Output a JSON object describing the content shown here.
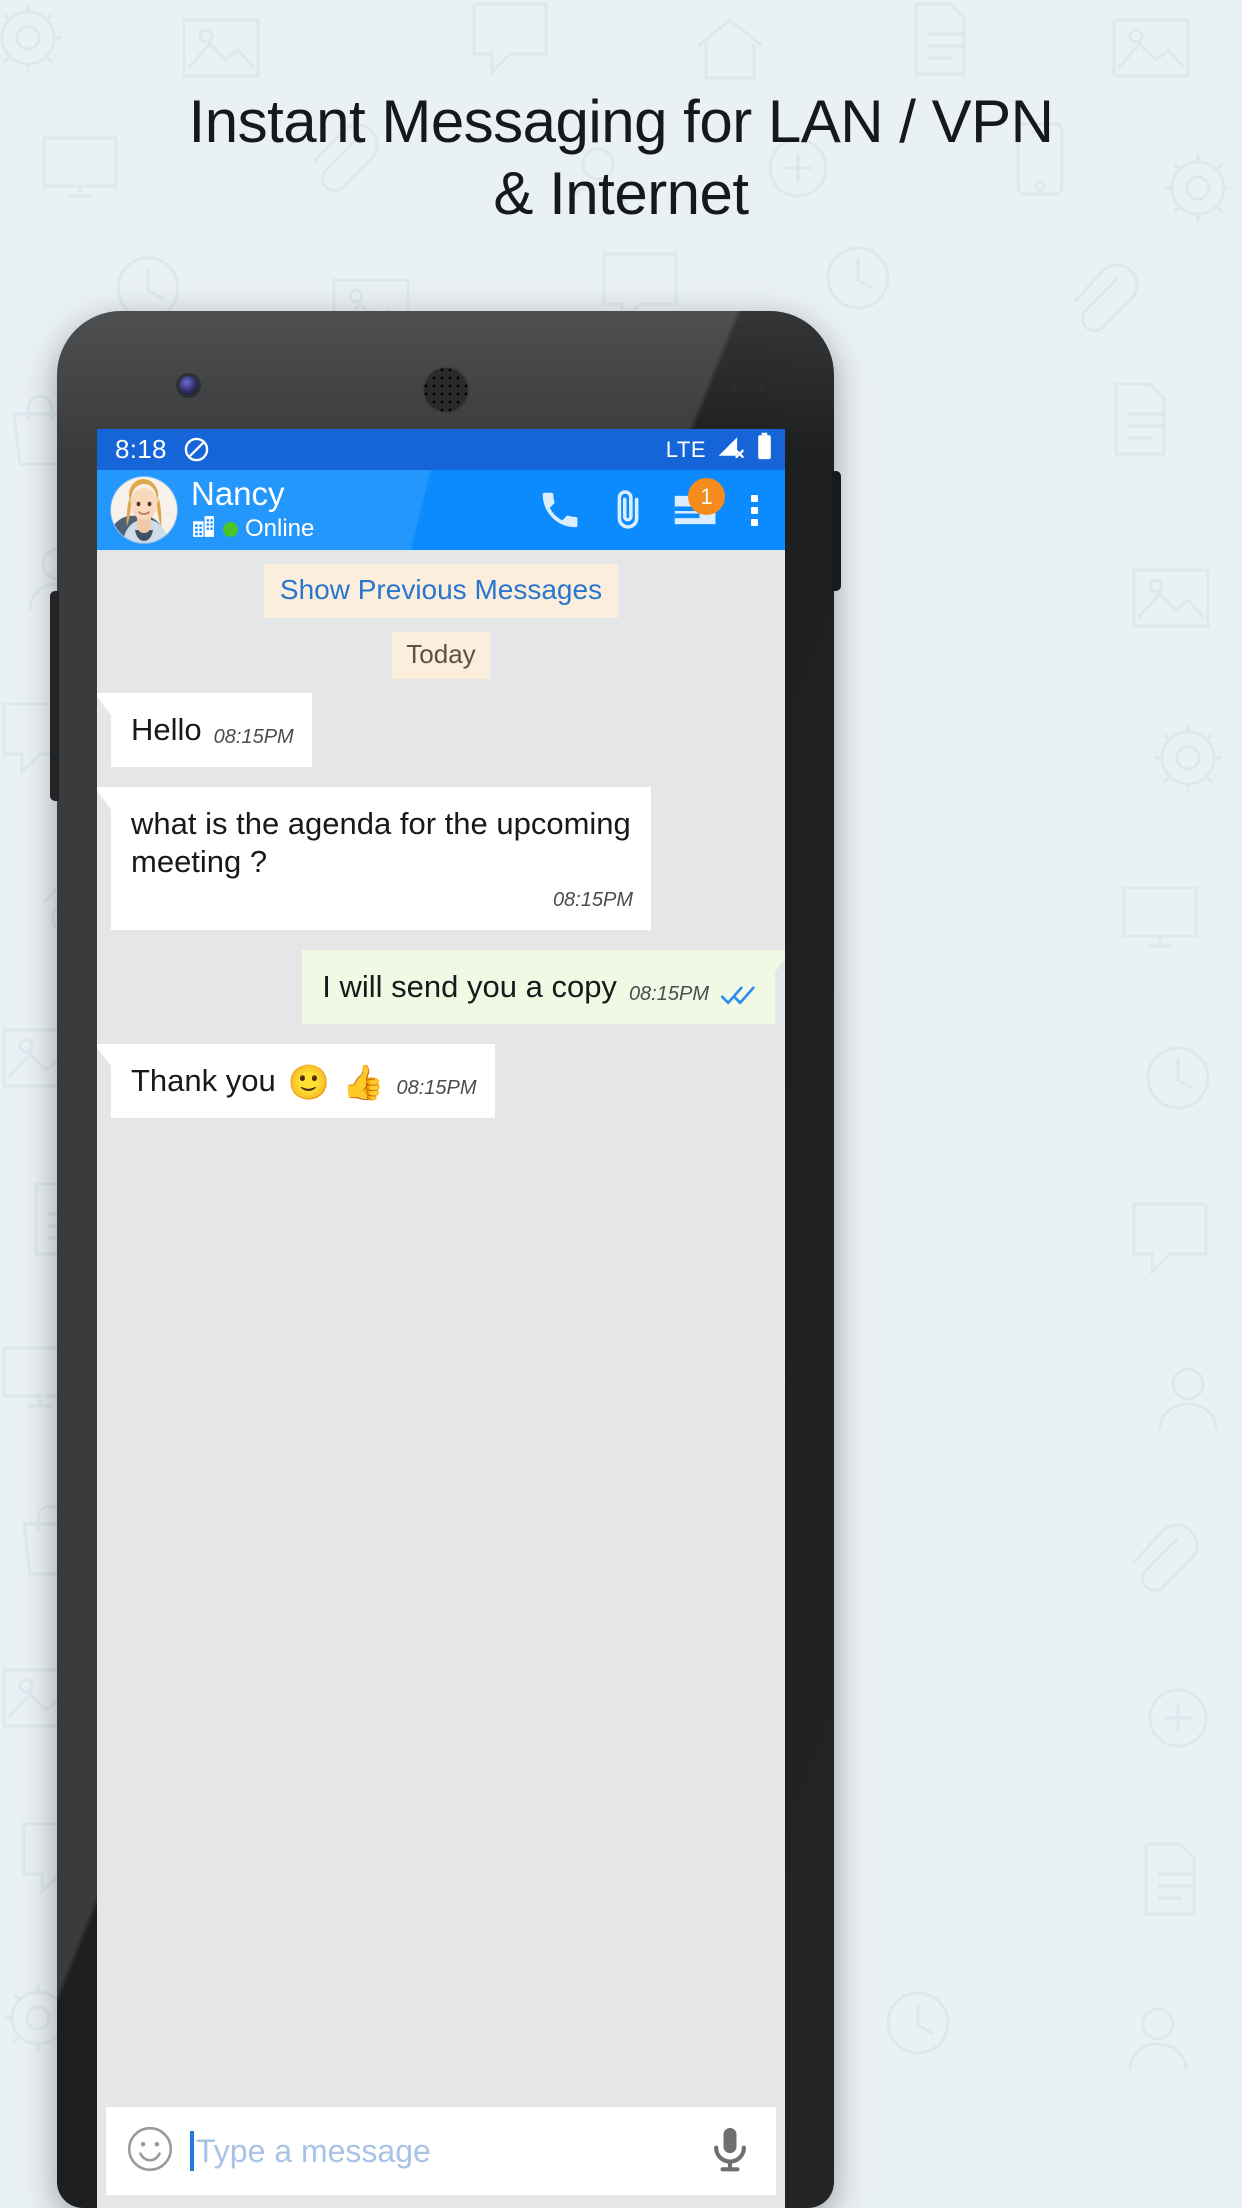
{
  "headline": {
    "line1": "Instant Messaging for LAN / VPN",
    "line2": "& Internet"
  },
  "status_bar": {
    "time": "8:18",
    "dnd_icon": "do-not-disturb-icon",
    "network_label": "LTE",
    "signal_icon": "signal-no-service-icon",
    "battery_icon": "battery-full-icon"
  },
  "app_bar": {
    "avatar": "contact-avatar",
    "contact_name": "Nancy",
    "org_icon": "building-icon",
    "presence_dot_color": "#48c626",
    "presence_text": "Online",
    "actions": {
      "call_label": "phone-icon",
      "attach_label": "paperclip-icon",
      "cards_label": "cards-icon",
      "cards_badge": "1",
      "badge_color": "#f78c1e",
      "overflow_label": "overflow-menu-icon"
    }
  },
  "chat": {
    "show_previous_label": "Show Previous Messages",
    "day_divider": "Today",
    "messages": [
      {
        "direction": "in",
        "text": "Hello",
        "time": "08:15PM",
        "layout": "inline",
        "emojis": []
      },
      {
        "direction": "in",
        "text": "what is the agenda for the upcoming meeting ?",
        "time": "08:15PM",
        "layout": "block",
        "emojis": []
      },
      {
        "direction": "out",
        "text": "I will send you a copy",
        "time": "08:15PM",
        "layout": "inline",
        "status": "read",
        "status_icon": "double-check-icon",
        "status_color": "#2a8ef0",
        "emojis": []
      },
      {
        "direction": "in",
        "text": "Thank you",
        "time": "08:15PM",
        "layout": "inline",
        "emojis": [
          "🙂",
          "👍"
        ]
      }
    ]
  },
  "composer": {
    "emoji_button": "emoji-smiley-icon",
    "placeholder": "Type a message",
    "value": "",
    "mic_button": "microphone-icon"
  },
  "colors": {
    "status_bar": "#1565d8",
    "app_bar": "#0b8bfd",
    "chat_background": "#e4e6e8",
    "incoming_bubble": "#ffffff",
    "outgoing_bubble": "#f1f8e4",
    "chip_background": "#fceedd",
    "link": "#2a76cf",
    "page_background": "#eaf1f5"
  }
}
